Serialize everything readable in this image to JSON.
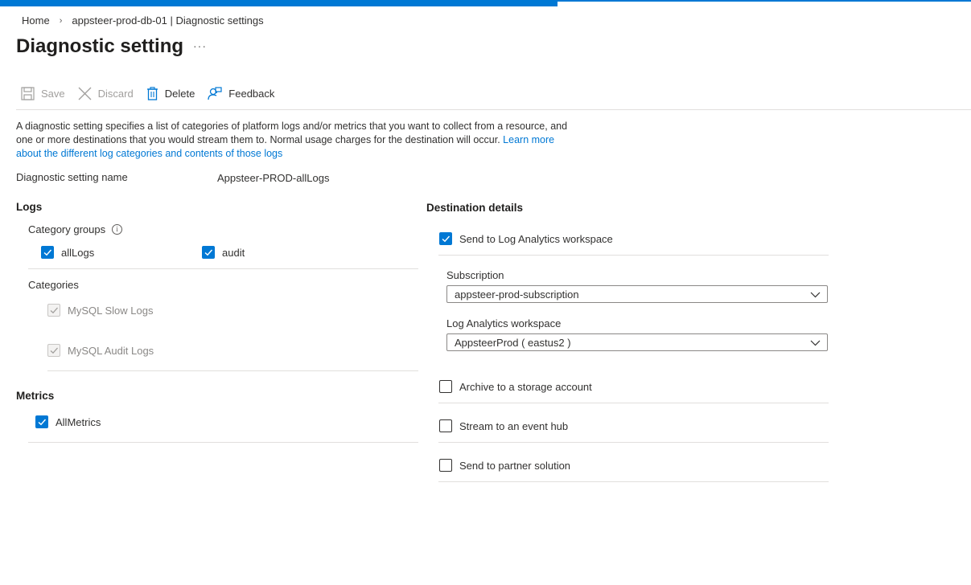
{
  "breadcrumb": {
    "home": "Home",
    "separator": "›",
    "current": "appsteer-prod-db-01 | Diagnostic settings"
  },
  "page": {
    "title": "Diagnostic setting",
    "more": "···"
  },
  "toolbar": {
    "save": "Save",
    "discard": "Discard",
    "delete": "Delete",
    "feedback": "Feedback"
  },
  "description": {
    "text": "A diagnostic setting specifies a list of categories of platform logs and/or metrics that you want to collect from a resource, and one or more destinations that you would stream them to. Normal usage charges for the destination will occur. ",
    "link": "Learn more about the different log categories and contents of those logs"
  },
  "setting_name": {
    "label": "Diagnostic setting name",
    "value": "Appsteer-PROD-allLogs"
  },
  "logs": {
    "heading": "Logs",
    "category_groups_label": "Category groups",
    "info_icon": "info-icon",
    "groups": [
      {
        "label": "allLogs",
        "checked": true
      },
      {
        "label": "audit",
        "checked": true
      }
    ],
    "categories_label": "Categories",
    "categories": [
      {
        "label": "MySQL Slow Logs",
        "checked": true,
        "disabled": true
      },
      {
        "label": "MySQL Audit Logs",
        "checked": true,
        "disabled": true
      }
    ]
  },
  "metrics": {
    "heading": "Metrics",
    "items": [
      {
        "label": "AllMetrics",
        "checked": true
      }
    ]
  },
  "destination": {
    "heading": "Destination details",
    "log_analytics": {
      "label": "Send to Log Analytics workspace",
      "checked": true
    },
    "subscription": {
      "label": "Subscription",
      "value": "appsteer-prod-subscription"
    },
    "workspace": {
      "label": "Log Analytics workspace",
      "value": "AppsteerProd ( eastus2 )"
    },
    "options": [
      {
        "label": "Archive to a storage account",
        "checked": false
      },
      {
        "label": "Stream to an event hub",
        "checked": false
      },
      {
        "label": "Send to partner solution",
        "checked": false
      }
    ]
  },
  "colors": {
    "accent": "#0078d4",
    "text": "#323130",
    "disabled": "#a19f9d",
    "divider": "#e1dfdd"
  }
}
